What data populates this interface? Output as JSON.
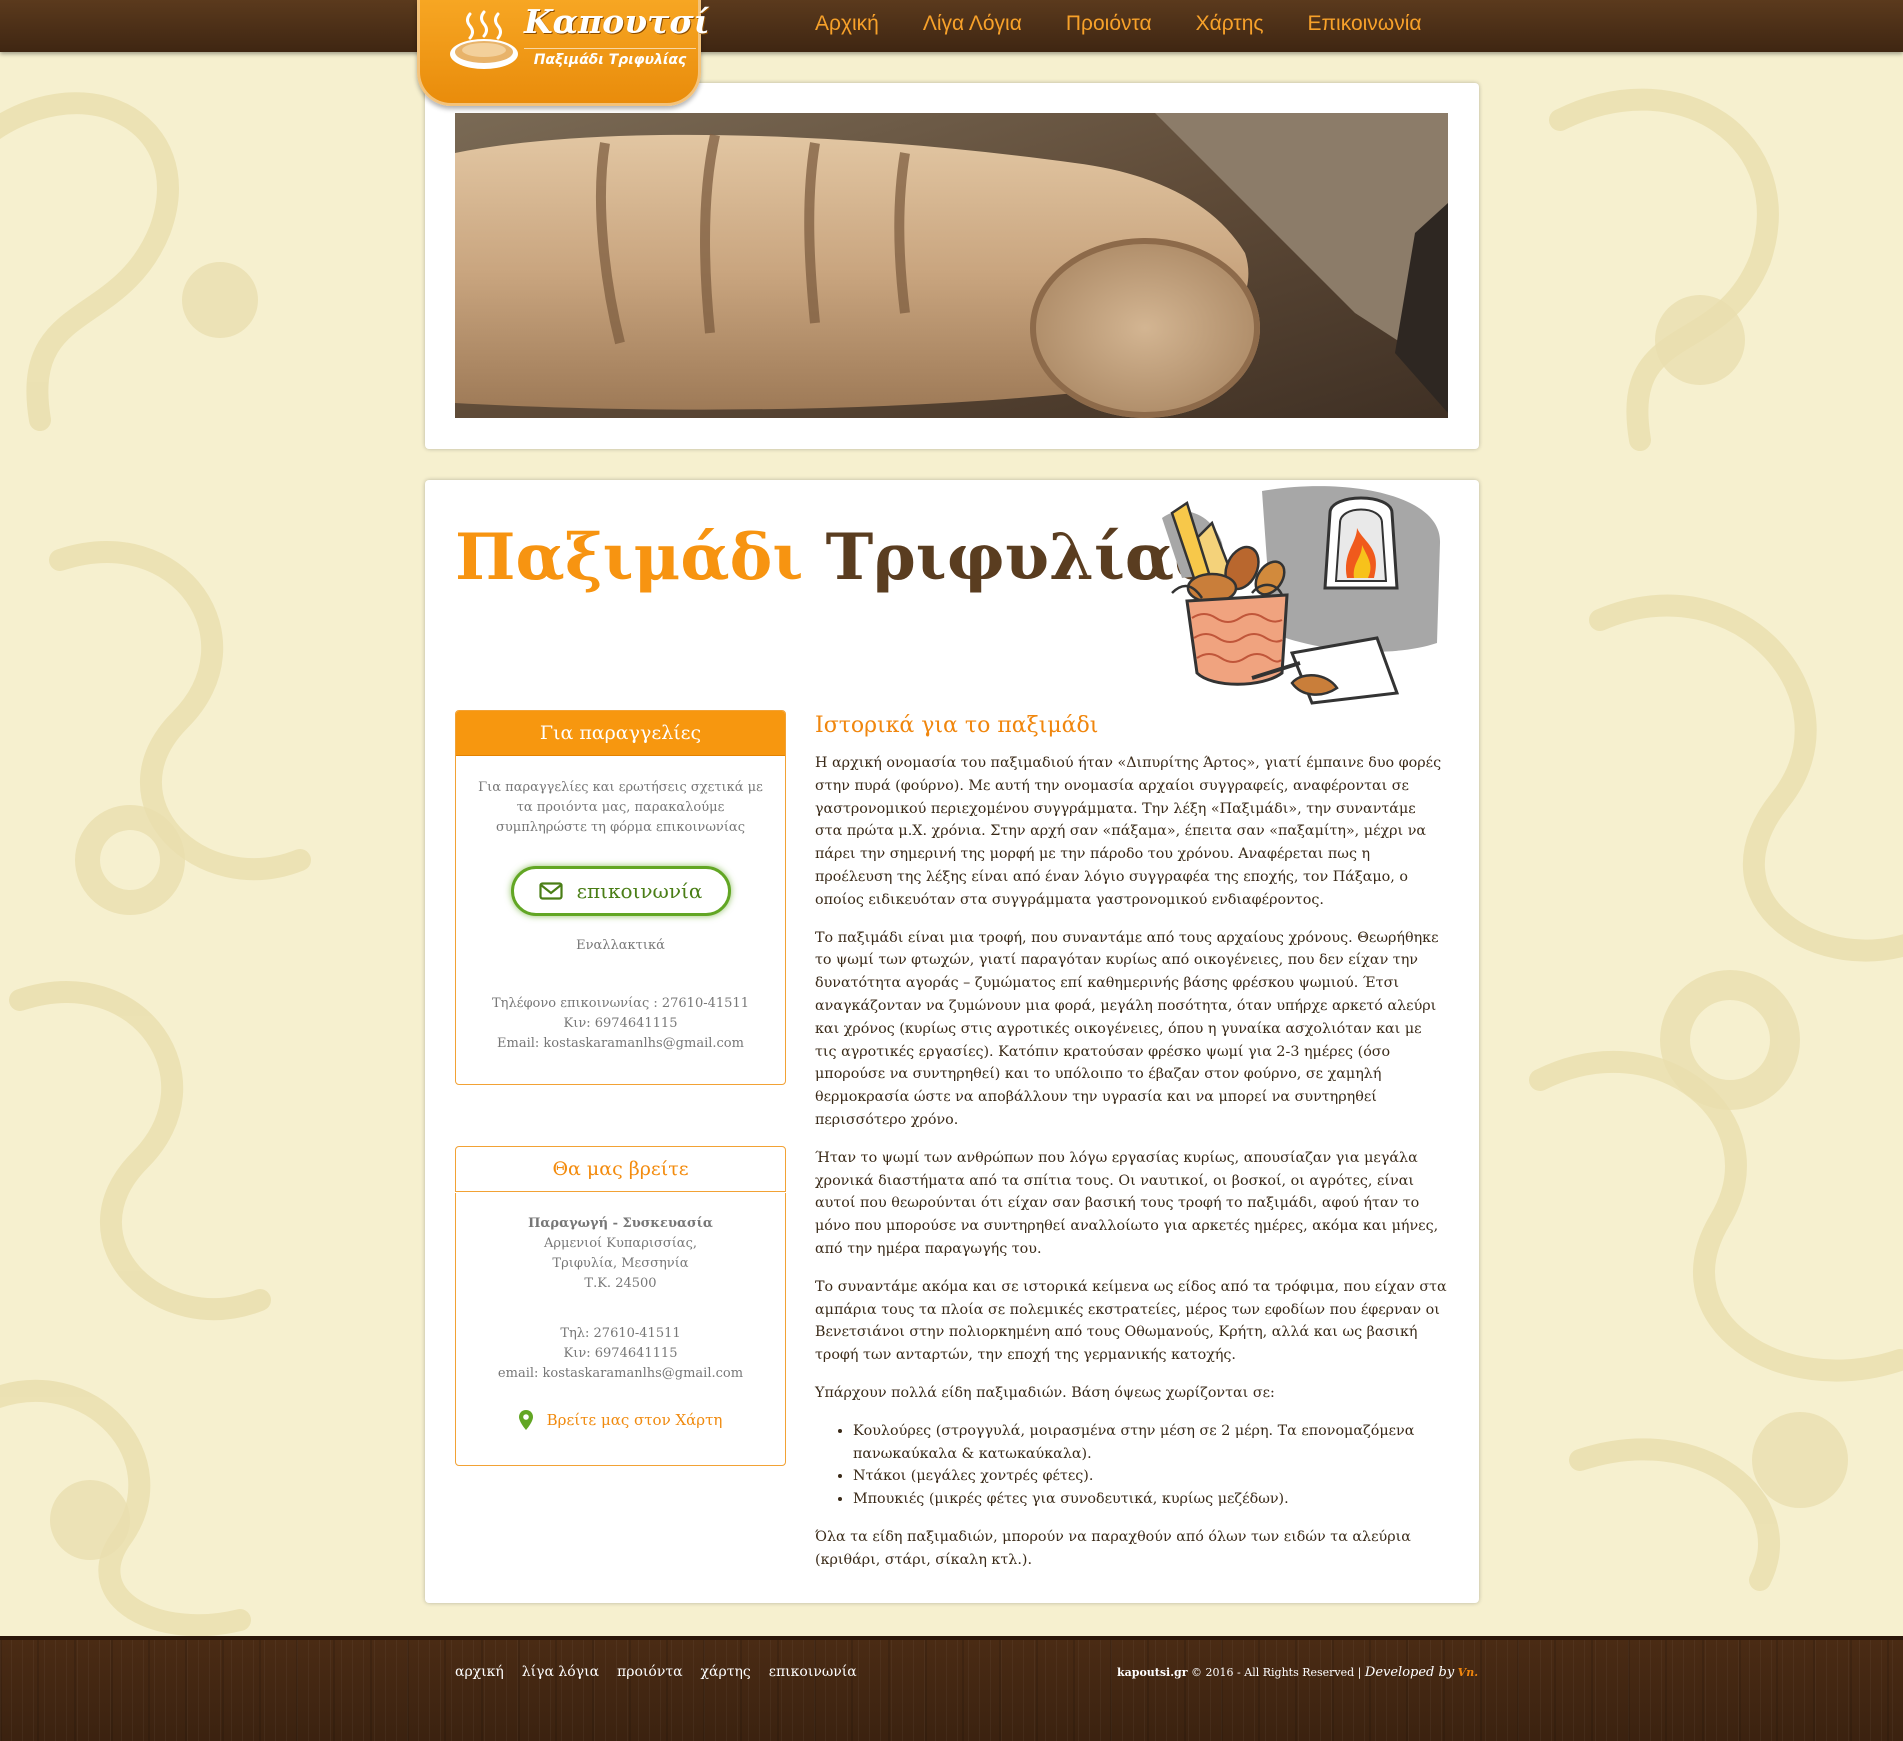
{
  "logo": {
    "name": "Καπουτσί",
    "tagline": "Παξιμάδι Τριφυλίας"
  },
  "nav": [
    "Αρχική",
    "Λίγα Λόγια",
    "Προιόντα",
    "Χάρτης",
    "Επικοινωνία"
  ],
  "page_title": {
    "bold": "Παξιμάδι",
    "normal": "Τριφυλίας"
  },
  "orders_box": {
    "title": "Για παραγγελίες",
    "intro": "Για παραγγελίες και ερωτήσεις σχετικά με τα προιόντα μας, παρακαλούμε συμπληρώστε τη φόρμα επικοινωνίας",
    "button": "επικοινωνία",
    "alt": "Εναλλακτικά",
    "phone": "Τηλέφονο επικοινωνίας : 27610-41511",
    "mobile": "Κιν: 6974641115",
    "email": "Email: kostaskaramanlhs@gmail.com"
  },
  "find_box": {
    "title": "Θα μας βρείτε",
    "heading": "Παραγωγή - Συσκευασία",
    "addr1": "Αρμενιοί Κυπαρισσίας,",
    "addr2": "Τριφυλία, Μεσσηνία",
    "zip": "Τ.Κ. 24500",
    "phone": "Τηλ: 27610-41511",
    "mobile": "Κιν: 6974641115",
    "email": "email: kostaskaramanlhs@gmail.com",
    "map_link": "Βρείτε μας στον Χάρτη"
  },
  "article": {
    "title": "Ιστορικά για το παξιμάδι",
    "p1": "Η αρχική ονομασία του παξιμαδιού ήταν «Διπυρίτης Άρτος», γιατί έμπαινε δυο φορές στην πυρά (φούρνο). Με αυτή την ονομασία αρχαίοι συγγραφείς, αναφέρονται σε γαστρονομικού περιεχομένου συγγράμματα. Την λέξη «Παξιμάδι», την συναντάμε στα πρώτα μ.Χ. χρόνια. Στην αρχή σαν «πάξαμα», έπειτα σαν «παξαμίτη», μέχρι να πάρει την σημερινή της μορφή με την πάροδο του χρόνου. Αναφέρεται πως η προέλευση της λέξης είναι από έναν λόγιο συγγραφέα της εποχής, τον Πάξαμο, ο οποίος ειδικευόταν στα συγγράμματα γαστρονομικού ενδιαφέροντος.",
    "p2": "Το παξιμάδι είναι μια τροφή, που συναντάμε από τους αρχαίους χρόνους. Θεωρήθηκε το ψωμί των φτωχών, γιατί παραγόταν κυρίως από οικογένειες, που δεν είχαν την δυνατότητα αγοράς – ζυμώματος επί καθημερινής βάσης φρέσκου ψωμιού. Έτσι αναγκάζονταν να ζυμώνουν μια φορά, μεγάλη ποσότητα, όταν υπήρχε αρκετό αλεύρι και χρόνος (κυρίως στις αγροτικές οικογένειες, όπου η γυναίκα ασχολιόταν και με τις αγροτικές εργασίες). Κατόπιν κρατούσαν φρέσκο ψωμί για 2-3 ημέρες (όσο μπορούσε να συντηρηθεί) και το υπόλοιπο το έβαζαν στον φούρνο, σε χαμηλή θερμοκρασία ώστε να αποβάλλουν την υγρασία και να μπορεί να συντηρηθεί περισσότερο χρόνο.",
    "p3": "Ήταν το ψωμί των ανθρώπων που λόγω εργασίας κυρίως, απουσίαζαν για μεγάλα χρονικά διαστήματα από τα σπίτια τους. Οι ναυτικοί, οι βοσκοί, οι αγρότες, είναι αυτοί που θεωρούνται ότι είχαν σαν βασική τους τροφή το παξιμάδι, αφού ήταν το μόνο που μπορούσε να συντηρηθεί αναλλοίωτο για αρκετές ημέρες, ακόμα και μήνες, από την ημέρα παραγωγής του.",
    "p4": "Το συναντάμε ακόμα και σε ιστορικά κείμενα ως είδος από τα τρόφιμα, που είχαν στα αμπάρια τους τα πλοία σε πολεμικές εκστρατείες, μέρος των εφοδίων που έφερναν οι Βενετσιάνοι στην πολιορκημένη από τους Οθωμανούς, Κρήτη, αλλά και ως βασική τροφή των ανταρτών, την εποχή της γερμανικής κατοχής.",
    "p5": "Υπάρχουν πολλά είδη παξιμαδιών. Βάση όψεως χωρίζονται σε:",
    "list": [
      "Κουλούρες (στρογγυλά, μοιρασμένα στην μέση σε 2 μέρη. Τα επονομαζόμενα πανωκαύκαλα & κατωκαύκαλα).",
      "Ντάκοι (μεγάλες χοντρές φέτες).",
      "Μπουκιές (μικρές φέτες για συνοδευτικά, κυρίως μεζέδων)."
    ],
    "p6": "Όλα τα είδη παξιμαδιών, μπορούν να παραχθούν από όλων των ειδών τα αλεύρια (κριθάρι, στάρι, σίκαλη κτλ.)."
  },
  "footer": {
    "links": [
      "αρχική",
      "λίγα λόγια",
      "προιόντα",
      "χάρτης",
      "επικοινωνία"
    ],
    "site": "kapoutsi.gr",
    "copyright": "© 2016 - All Rights Reserved |",
    "dev": "Developed by",
    "dev_mark": "Vn."
  },
  "colors": {
    "accent": "#f7970f",
    "brown": "#4a2b14",
    "green": "#62a624",
    "background": "#f6f0cf"
  }
}
